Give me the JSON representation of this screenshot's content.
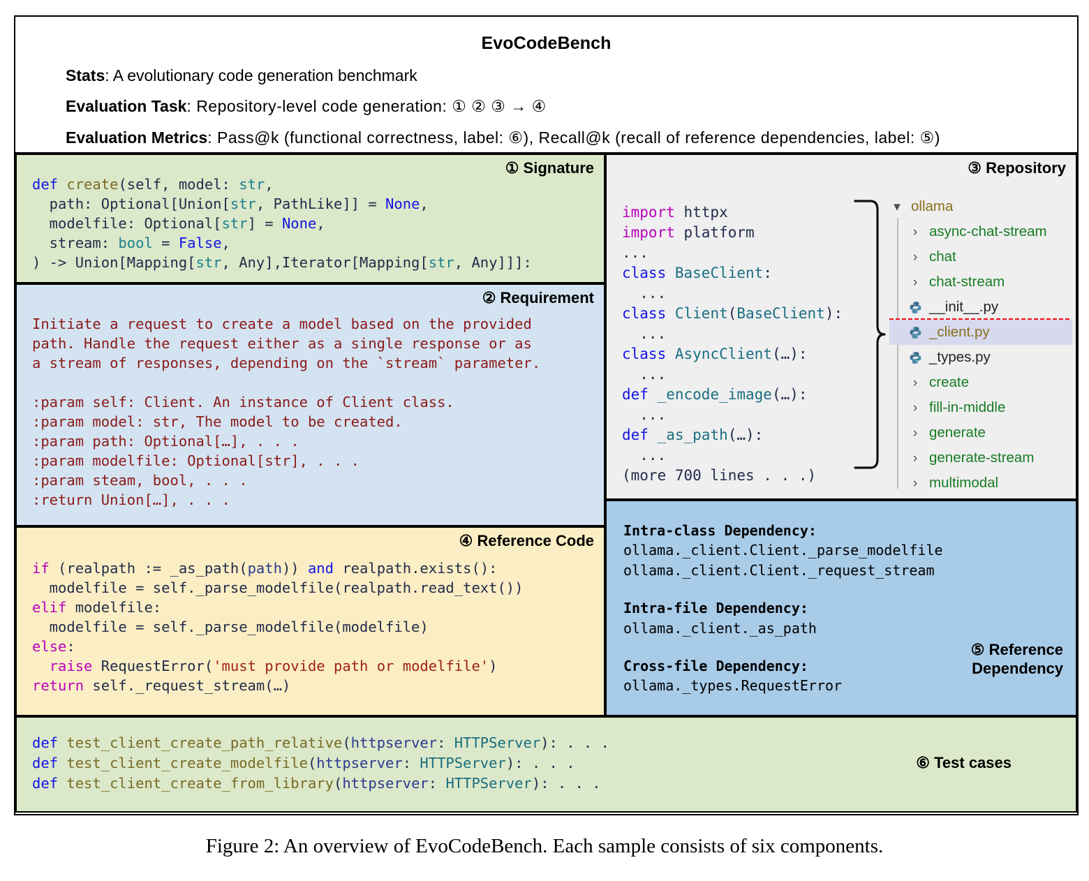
{
  "header": {
    "title": "EvoCodeBench",
    "lines": [
      {
        "label": "Stats",
        "text": ": A evolutionary code generation benchmark"
      },
      {
        "label": "Evaluation Task",
        "text": ": Repository-level code generation: ① ② ③ → ④"
      },
      {
        "label": "Evaluation Metrics",
        "text": ": Pass@k (functional correctness, label: ⑥), Recall@k (recall of reference dependencies, label: ⑤)"
      }
    ]
  },
  "panels": {
    "signature": {
      "label": "① Signature",
      "code_lines": [
        "def create(self, model: str,",
        "  path: Optional[Union[str, PathLike]] = None,",
        "  modelfile: Optional[str] = None,",
        "  stream: bool = False,",
        ") -> Union[Mapping[str, Any],Iterator[Mapping[str, Any]]]:"
      ]
    },
    "requirement": {
      "label": "② Requirement",
      "text": "Initiate a request to create a model based on the provided\npath. Handle the request either as a single response or as\na stream of responses, depending on the `stream` parameter.\n\n:param self: Client. An instance of Client class.\n:param model: str, The model to be created.\n:param path: Optional[…], . . .\n:param modelfile: Optional[str], . . .\n:param steam, bool, . . .\n:return Union[…], . . ."
    },
    "reference_code": {
      "label": "④ Reference Code",
      "code_lines": [
        "if (realpath := _as_path(path)) and realpath.exists():",
        "  modelfile = self._parse_modelfile(realpath.read_text())",
        "elif modelfile:",
        "  modelfile = self._parse_modelfile(modelfile)",
        "else:",
        "  raise RequestError('must provide path or modelfile')",
        "return self._request_stream(…)"
      ]
    },
    "repository": {
      "label": "③ Repository",
      "code_lines": [
        "import httpx",
        "import platform",
        "...",
        "class BaseClient:",
        "  ...",
        "class Client(BaseClient):",
        "  ...",
        "class AsyncClient(…):",
        "  ...",
        "def _encode_image(…):",
        "  ...",
        "def _as_path(…):",
        "  ...",
        "(more 700 lines . . .)"
      ],
      "tree": [
        {
          "name": "ollama",
          "kind": "root",
          "icon": "chevron-down-icon",
          "highlighted": false
        },
        {
          "name": "async-chat-stream",
          "kind": "dir",
          "icon": "chevron-right-icon",
          "highlighted": false
        },
        {
          "name": "chat",
          "kind": "dir",
          "icon": "chevron-right-icon",
          "highlighted": false
        },
        {
          "name": "chat-stream",
          "kind": "dir",
          "icon": "chevron-right-icon",
          "highlighted": false
        },
        {
          "name": "__init__.py",
          "kind": "file",
          "icon": "python-file-icon",
          "highlighted": false
        },
        {
          "name": "_client.py",
          "kind": "file",
          "icon": "python-file-icon",
          "highlighted": true
        },
        {
          "name": "_types.py",
          "kind": "file",
          "icon": "python-file-icon",
          "highlighted": false
        },
        {
          "name": "create",
          "kind": "dir",
          "icon": "chevron-right-icon",
          "highlighted": false
        },
        {
          "name": "fill-in-middle",
          "kind": "dir",
          "icon": "chevron-right-icon",
          "highlighted": false
        },
        {
          "name": "generate",
          "kind": "dir",
          "icon": "chevron-right-icon",
          "highlighted": false
        },
        {
          "name": "generate-stream",
          "kind": "dir",
          "icon": "chevron-right-icon",
          "highlighted": false
        },
        {
          "name": "multimodal",
          "kind": "dir",
          "icon": "chevron-right-icon",
          "highlighted": false
        }
      ]
    },
    "reference_dependency": {
      "label_line1": "⑤ Reference",
      "label_line2": "Dependency",
      "groups": [
        {
          "heading": "Intra-class Dependency:",
          "items": [
            "ollama._client.Client._parse_modelfile",
            "ollama._client.Client._request_stream"
          ]
        },
        {
          "heading": "Intra-file Dependency:",
          "items": [
            "ollama._client._as_path"
          ]
        },
        {
          "heading": "Cross-file Dependency:",
          "items": [
            "ollama._types.RequestError"
          ]
        }
      ]
    },
    "test_cases": {
      "label": "⑥ Test cases",
      "code_lines": [
        "def test_client_create_path_relative(httpserver: HTTPServer): . . .",
        "def test_client_create_modelfile(httpserver: HTTPServer): . . .",
        "def test_client_create_from_library(httpserver: HTTPServer): . . ."
      ]
    }
  },
  "caption": "Figure 2: An overview of EvoCodeBench. Each sample consists of six components.",
  "colors": {
    "signature_bg": "#dbe8c9",
    "requirement_bg": "#d4e3f1",
    "refcode_bg": "#fbeec4",
    "repository_bg": "#efeff0",
    "refdep_bg": "#a8cbe8",
    "tests_bg": "#dbe8c9",
    "highlight_border": "#f01010",
    "requirement_text": "#8b1a1a"
  }
}
